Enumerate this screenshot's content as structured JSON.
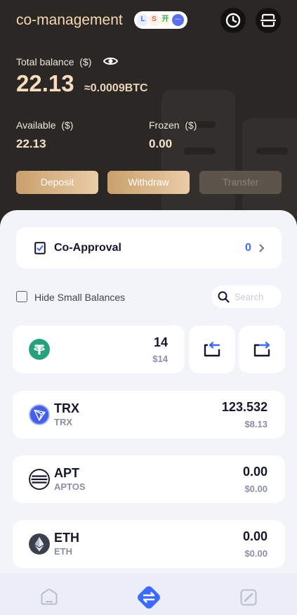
{
  "header": {
    "title": "co-management",
    "members": [
      "L",
      "S",
      "开",
      "···"
    ]
  },
  "balance": {
    "total_label": "Total balance",
    "currency_label": "($)",
    "total_value": "22.13",
    "btc_value": "≈0.0009BTC",
    "available_label": "Available",
    "available_currency": "($)",
    "available_value": "22.13",
    "frozen_label": "Frozen",
    "frozen_currency": "($)",
    "frozen_value": "0.00"
  },
  "actions": {
    "deposit": "Deposit",
    "withdraw": "Withdraw",
    "transfer": "Transfer"
  },
  "approval": {
    "label": "Co-Approval",
    "count": "0"
  },
  "filters": {
    "hide_small": "Hide Small Balances",
    "search_placeholder": "Search"
  },
  "tokens": [
    {
      "symbol": "",
      "network": "",
      "amount": "14",
      "usd": "$14",
      "icon": "tether-icon"
    },
    {
      "symbol": "TRX",
      "network": "TRX",
      "amount": "123.532",
      "usd": "$8.13",
      "icon": "tron-icon"
    },
    {
      "symbol": "APT",
      "network": "APTOS",
      "amount": "0.00",
      "usd": "$0.00",
      "icon": "aptos-icon"
    },
    {
      "symbol": "ETH",
      "network": "ETH",
      "amount": "0.00",
      "usd": "$0.00",
      "icon": "ethereum-icon"
    }
  ],
  "colors": {
    "accent": "#3d6bff",
    "gold": "#caa06c",
    "dark_bg": "#2b2725"
  }
}
